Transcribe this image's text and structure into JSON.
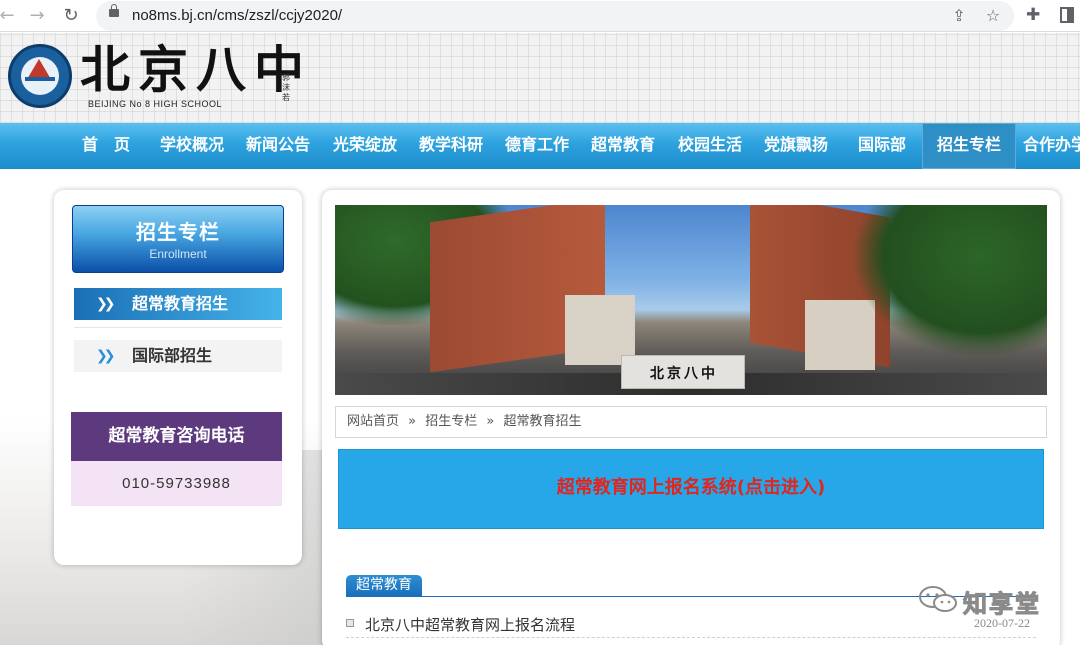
{
  "browser": {
    "url": "no8ms.bj.cn/cms/zszl/ccjy2020/"
  },
  "header": {
    "school_name": "北京八中",
    "school_name_en": "BEIJING No 8 HIGH SCHOOL",
    "calligraphy_sign": "郭沫若"
  },
  "nav": {
    "items": [
      {
        "label": "首　页"
      },
      {
        "label": "学校概况"
      },
      {
        "label": "新闻公告"
      },
      {
        "label": "光荣绽放"
      },
      {
        "label": "教学科研"
      },
      {
        "label": "德育工作"
      },
      {
        "label": "超常教育"
      },
      {
        "label": "校园生活"
      },
      {
        "label": "党旗飘扬"
      },
      {
        "label": "国际部"
      },
      {
        "label": "招生专栏",
        "active": true
      },
      {
        "label": "合作办学"
      }
    ]
  },
  "sidebar": {
    "title_cn": "招生专栏",
    "title_en": "Enrollment",
    "menu": [
      {
        "label": "超常教育招生",
        "active": true
      },
      {
        "label": "国际部招生"
      }
    ],
    "contact_title": "超常教育咨询电话",
    "contact_phone": "010-59733988"
  },
  "banner": {
    "gate_text": "北京八中"
  },
  "breadcrumb": {
    "items": [
      "网站首页",
      "»",
      "招生专栏",
      "»",
      "超常教育招生"
    ]
  },
  "register": {
    "label": "超常教育网上报名系统(点击进入)"
  },
  "section": {
    "title": "超常教育",
    "news": [
      {
        "title": "北京八中超常教育网上报名流程",
        "date": "2020-07-22"
      }
    ]
  },
  "watermark": {
    "text": "知享堂"
  },
  "colors": {
    "nav_blue": "#2ca2de",
    "contact_purple": "#5d3a7e",
    "register_blue": "#27a6e8",
    "register_text_red": "#e0261f"
  }
}
